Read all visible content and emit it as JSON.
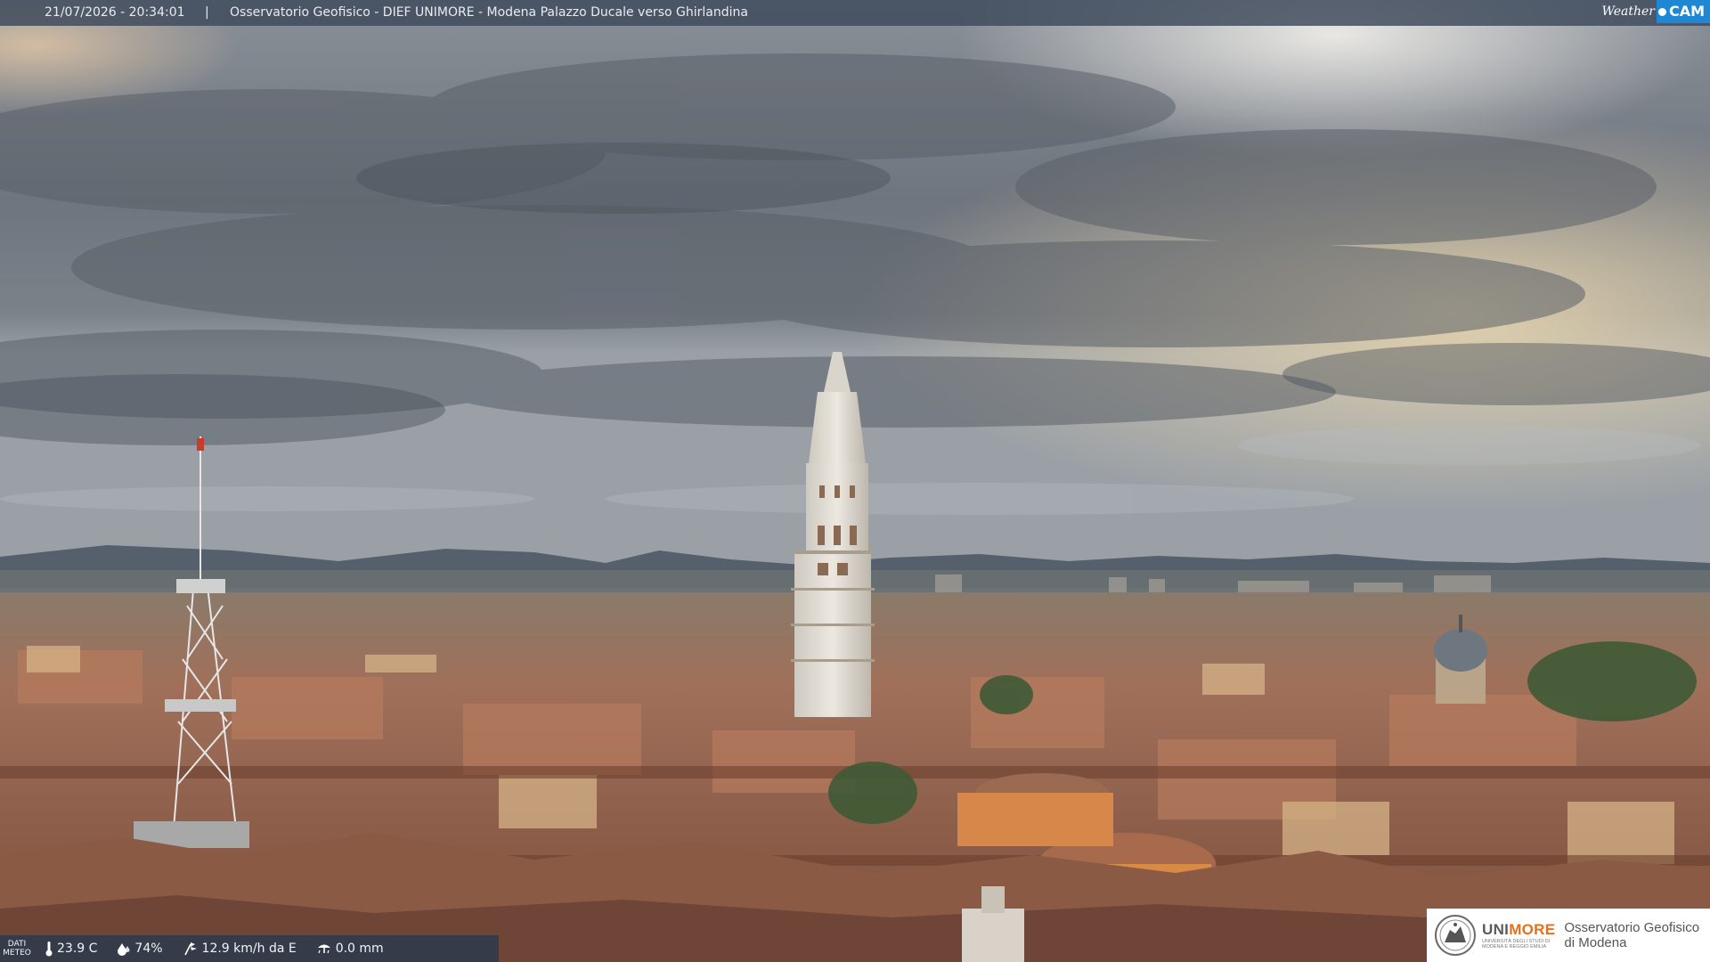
{
  "header": {
    "datetime": "21/07/2026 - 20:34:01",
    "separator": "|",
    "title": "Osservatorio Geofisico - DIEF UNIMORE - Modena Palazzo Ducale verso Ghirlandina"
  },
  "brand": {
    "weather": "Weather",
    "cam": "CAM",
    "accent_color": "#1e88d4"
  },
  "meteo": {
    "label_line1": "DATI",
    "label_line2": "METEO",
    "temperature": "23.9 C",
    "humidity": "74%",
    "wind": "12.9 km/h da E",
    "rain": "0.0 mm",
    "icons": [
      "thermometer-icon",
      "humidity-drop-icon",
      "wind-icon",
      "rain-gauge-icon"
    ]
  },
  "logo": {
    "uni": "UNI",
    "more": "MORE",
    "sub_line1": "UNIVERSITÀ DEGLI STUDI DI",
    "sub_line2": "MODENA E REGGIO EMILIA",
    "obs_line1": "Osservatorio Geofisico",
    "obs_line2": "di Modena",
    "accent_color": "#e2711d"
  },
  "scene": {
    "sky_color": "#7a8088",
    "cloud_color": "#5d636c",
    "sunset_glow_color": "#e8d2a8",
    "mountain_color": "#5b6470",
    "roof_color": "#a8694a",
    "tower_color": "#e4e0d8"
  }
}
